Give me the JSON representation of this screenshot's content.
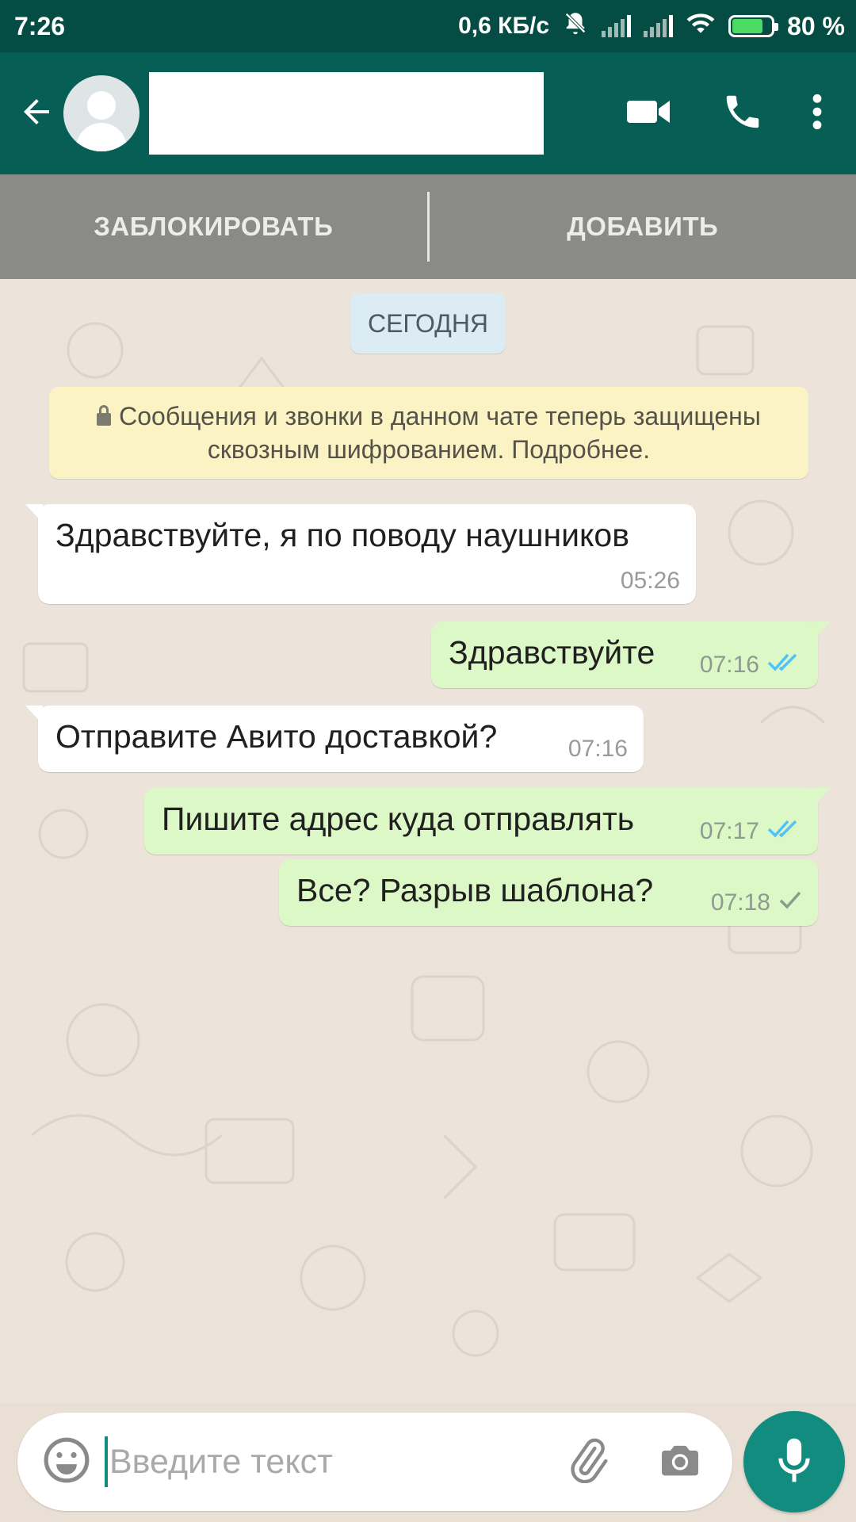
{
  "status_bar": {
    "time": "7:26",
    "net_speed": "0,6 КБ/с",
    "battery_percent": "80 %",
    "battery_level": 0.8
  },
  "header": {
    "contact_name": "",
    "icons": [
      "back-arrow-icon",
      "video-call-icon",
      "voice-call-icon",
      "more-vert-icon"
    ]
  },
  "action_bar": {
    "block_label": "ЗАБЛОКИРОВАТЬ",
    "add_label": "ДОБАВИТЬ"
  },
  "chat": {
    "date_chip": "СЕГОДНЯ",
    "encryption_notice": "Сообщения и звонки в данном чате теперь защищены сквозным шифрованием. Подробнее.",
    "messages": [
      {
        "direction": "in",
        "text": "Здравствуйте, я по поводу наушников",
        "time": "05:26"
      },
      {
        "direction": "out",
        "text": "Здравствуйте",
        "time": "07:16",
        "status": "read"
      },
      {
        "direction": "in",
        "text": "Отправите Авито доставкой?",
        "time": "07:16"
      },
      {
        "direction": "out",
        "text": "Пишите адрес куда отправлять",
        "time": "07:17",
        "status": "read"
      },
      {
        "direction": "out",
        "text": "Все? Разрыв шаблона?",
        "time": "07:18",
        "status": "sent"
      }
    ]
  },
  "composer": {
    "placeholder": "Введите текст",
    "value": ""
  },
  "colors": {
    "status_bar": "#054d44",
    "app_bar": "#075e54",
    "outgoing_bubble": "#dcf8c6",
    "incoming_bubble": "#ffffff",
    "read_ticks": "#4fc3f7",
    "mic_button": "#128c7e"
  }
}
